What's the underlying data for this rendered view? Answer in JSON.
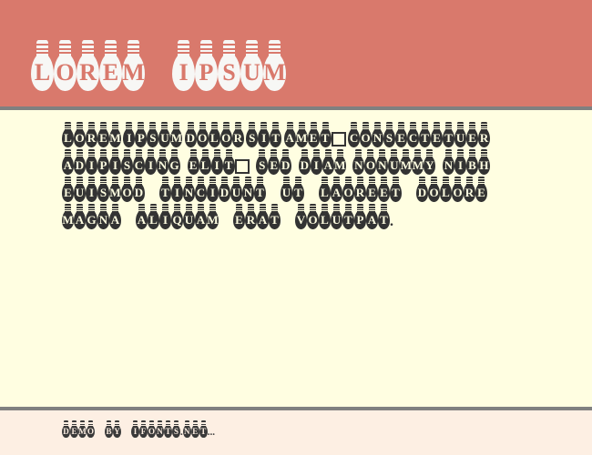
{
  "page": {
    "background": "#fffee1",
    "divider_color": "#808080"
  },
  "header": {
    "background": "#d9796c",
    "text_color": "#f7f7f5",
    "title": "LOREM IPSUM",
    "words": [
      "LOREM",
      "IPSUM"
    ]
  },
  "main": {
    "background": "#fffee1",
    "text_color": "#333333",
    "paragraph": "Lorem ipsum dolor sit amet□ consectetuer adipiscing elit□ sed diam nonummy nibh euismod tincidunt ut laoreet dolore magna aliquam erat volutpat.",
    "lines": [
      {
        "line": "Lorem ipsum dolor sit amet□ consectetuer",
        "tokens": [
          "LOREM",
          "IPSUM",
          "DOLOR",
          "SIT",
          "AMET□",
          "CONSECTETUER"
        ]
      },
      {
        "line": "adipiscing elit□ sed diam nonummy nibh",
        "tokens": [
          "ADIPISCING",
          "ELIT□",
          "SED",
          "DIAM",
          "NONUMMY",
          "NIBH"
        ]
      },
      {
        "line": "euismod tincidunt ut laoreet dolore",
        "tokens": [
          "EUISMOD",
          "TINCIDUNT",
          "UT",
          "LAOREET",
          "DOLORE"
        ]
      },
      {
        "line": "magna aliquam erat volutpat.",
        "tokens": [
          "MAGNA",
          "ALIQUAM",
          "ERAT",
          "VOLUTPAT."
        ]
      }
    ]
  },
  "footer": {
    "background": "#fdefe3",
    "text_color": "#3a3a3a",
    "text": "Demo by Ifonts.net...",
    "tokens": [
      "DEMO",
      "BY",
      "IFONTS.NET..."
    ]
  }
}
